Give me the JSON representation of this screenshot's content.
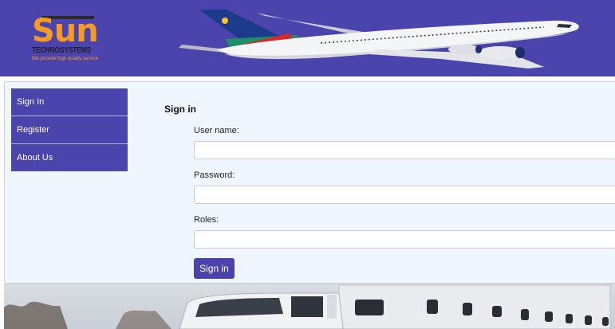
{
  "brand": {
    "logo_main": "Sun",
    "logo_sub": "TECHNOSYSTEMS",
    "tagline": "We provide high quality service",
    "header_color": "#4b44ad",
    "accent_color": "#f59a23"
  },
  "menu": {
    "items": [
      {
        "label": "Sign In"
      },
      {
        "label": "Register"
      },
      {
        "label": "About Us"
      }
    ]
  },
  "form": {
    "title": "Sign in",
    "username_label": "User name:",
    "username_value": "",
    "password_label": "Password:",
    "password_value": "",
    "roles_label": "Roles:",
    "roles_value": "",
    "submit_label": "Sign in"
  },
  "images": {
    "header_image": "airplane",
    "footer_image": "truck"
  }
}
